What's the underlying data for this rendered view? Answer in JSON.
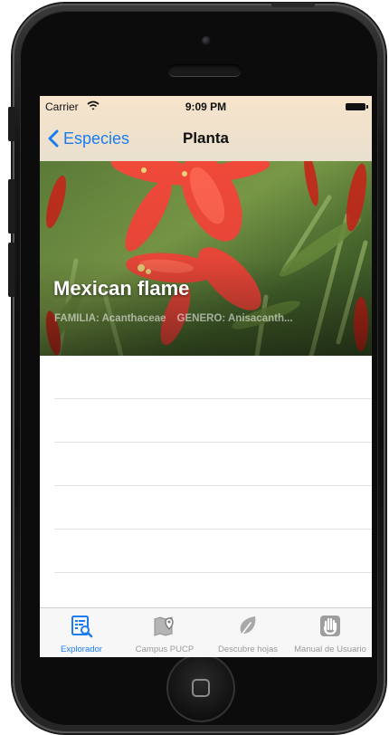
{
  "status_bar": {
    "carrier": "Carrier",
    "time": "9:09 PM",
    "icons": [
      "wifi-icon",
      "battery-icon"
    ]
  },
  "nav_bar": {
    "back_label": "Especies",
    "title": "Planta",
    "back_icon": "chevron-left-icon",
    "tint_color": "#1a7cf1"
  },
  "plant": {
    "name": "Mexican flame",
    "meta_family": "FAMILIA: Acanthaceae",
    "meta_genus": "GENERO: Anisacanth..."
  },
  "tab_bar": {
    "active_color": "#1a7cf1",
    "inactive_color": "#9a9a9a",
    "items": [
      {
        "label": "Explorador",
        "icon": "explorer-icon",
        "active": true
      },
      {
        "label": "Campus PUCP",
        "icon": "map-pin-icon",
        "active": false
      },
      {
        "label": "Descubre hojas",
        "icon": "leaf-icon",
        "active": false
      },
      {
        "label": "Manual de Usuario",
        "icon": "hand-icon",
        "active": false
      }
    ]
  }
}
